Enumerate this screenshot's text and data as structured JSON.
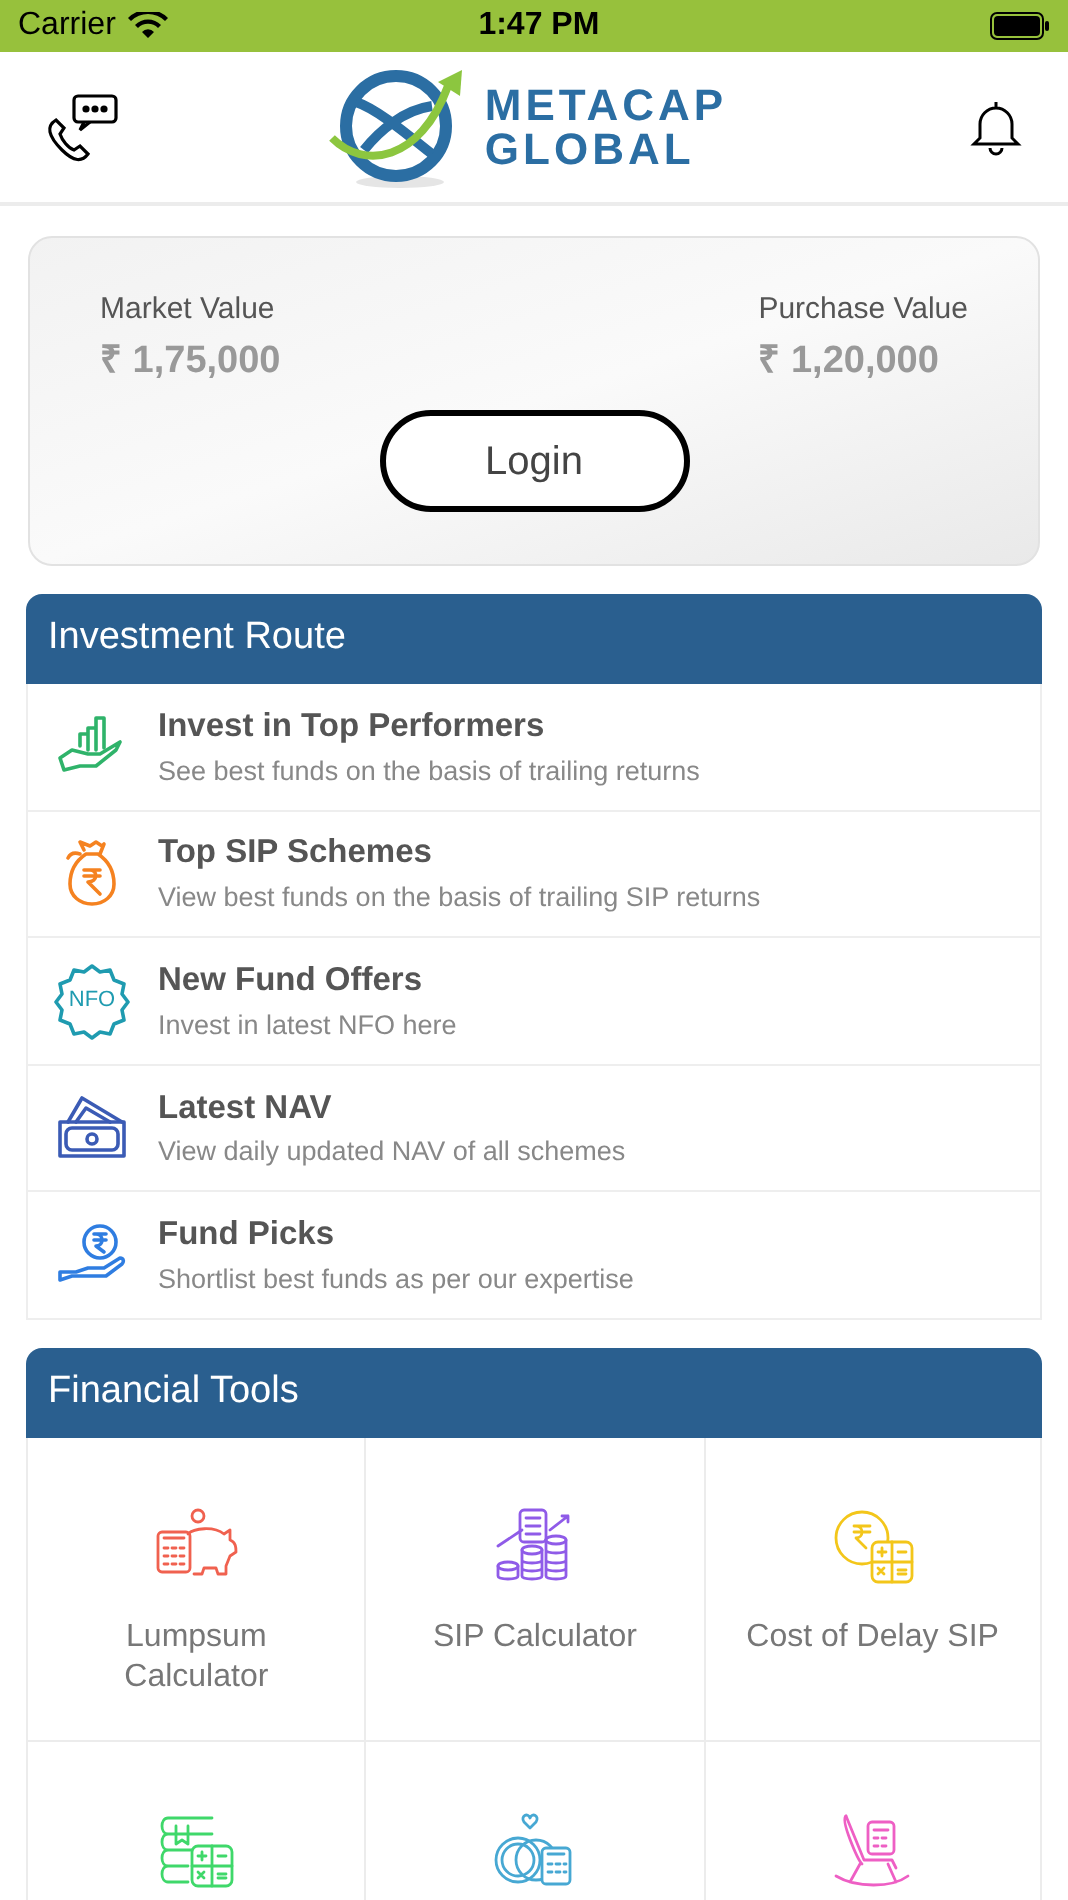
{
  "status_bar": {
    "carrier": "Carrier",
    "time": "1:47 PM"
  },
  "header": {
    "logo_line_1": "METACAP",
    "logo_line_2": "GLOBAL"
  },
  "portfolio_card": {
    "market_label": "Market Value",
    "market_value": "₹ 1,75,000",
    "purchase_label": "Purchase Value",
    "purchase_value": "₹ 1,20,000",
    "login_button": "Login"
  },
  "investment_route": {
    "title": "Investment Route",
    "items": [
      {
        "kind": "chart-hand",
        "title": "Invest in Top Performers",
        "subtitle": "See best funds on the basis of trailing returns"
      },
      {
        "kind": "money-bag",
        "title": "Top SIP Schemes",
        "subtitle": "View best funds on the basis of trailing SIP returns"
      },
      {
        "kind": "nfo",
        "badge": "NFO",
        "title": "New Fund Offers",
        "subtitle": "Invest in latest NFO here"
      },
      {
        "kind": "cash",
        "title": "Latest NAV",
        "subtitle": "View daily updated NAV of all schemes"
      },
      {
        "kind": "rupee-hand",
        "title": "Fund Picks",
        "subtitle": "Shortlist best funds as per our expertise"
      }
    ]
  },
  "financial_tools": {
    "title": "Financial Tools",
    "items": [
      {
        "kind": "piggy",
        "label": "Lumpsum Calculator"
      },
      {
        "kind": "coins",
        "label": "SIP Calculator"
      },
      {
        "kind": "rupee-calc",
        "label": "Cost of Delay SIP"
      },
      {
        "kind": "books"
      },
      {
        "kind": "rings"
      },
      {
        "kind": "chair"
      }
    ]
  }
}
